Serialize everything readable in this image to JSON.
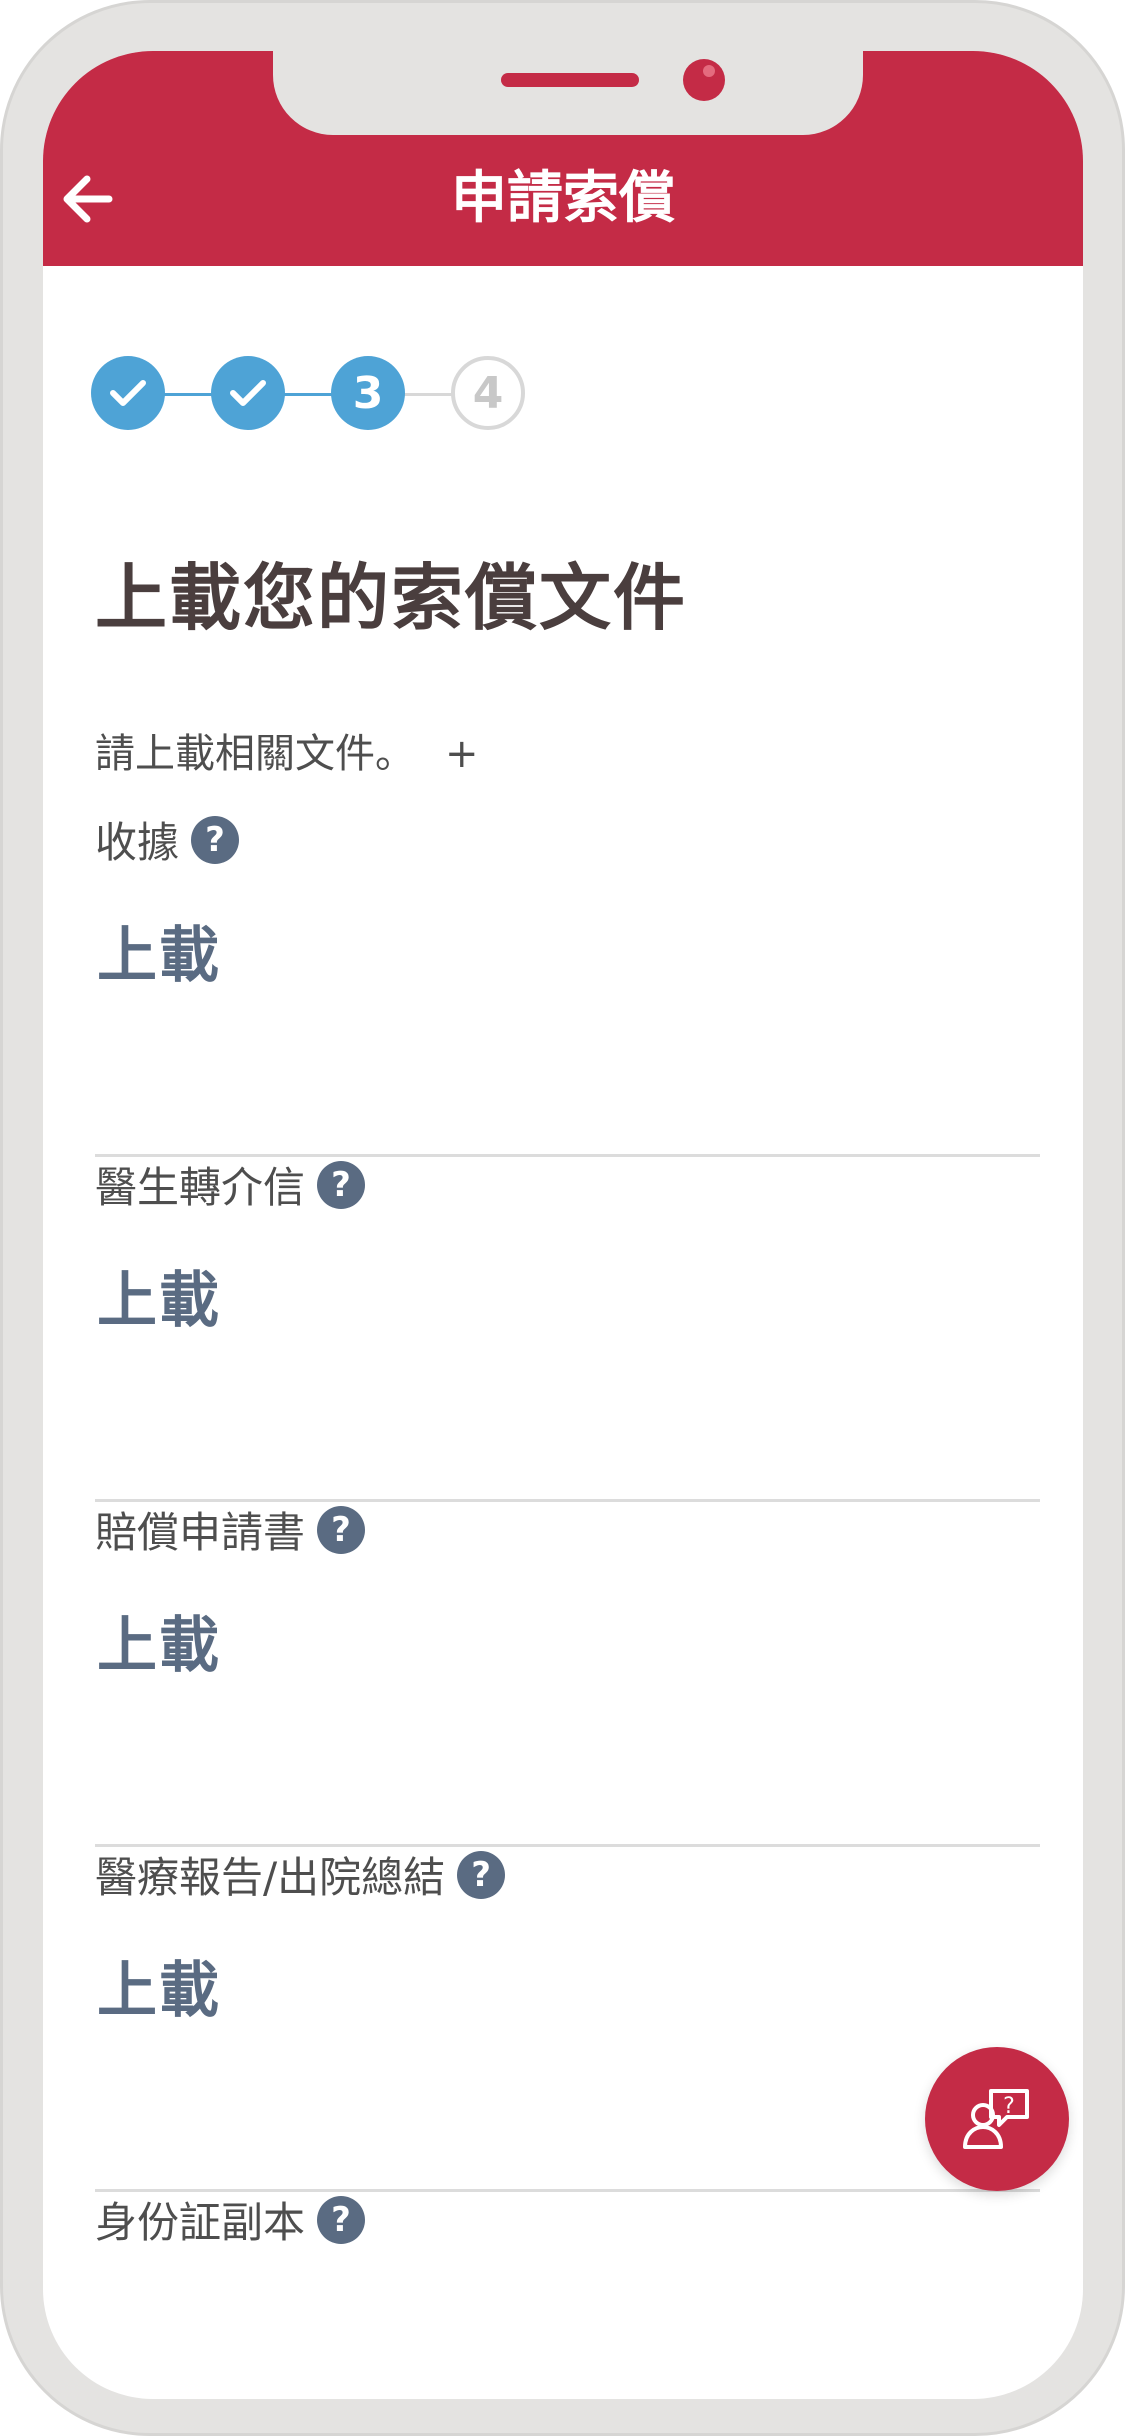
{
  "header": {
    "title": "申請索償",
    "back_icon": "arrow-left-icon"
  },
  "steps": [
    {
      "state": "done",
      "label": ""
    },
    {
      "state": "done",
      "label": ""
    },
    {
      "state": "current",
      "label": "3"
    },
    {
      "state": "todo",
      "label": "4"
    }
  ],
  "page": {
    "heading": "上載您的索償文件",
    "intro": "請上載相關文件。",
    "intro_plus": "+"
  },
  "documents": [
    {
      "label": "收據",
      "help": "?",
      "action": "上載"
    },
    {
      "label": "醫生轉介信",
      "help": "?",
      "action": "上載"
    },
    {
      "label": "賠償申請書",
      "help": "?",
      "action": "上載"
    },
    {
      "label": "醫療報告/出院總結",
      "help": "?",
      "action": "上載"
    },
    {
      "label": "身份証副本",
      "help": "?",
      "action": ""
    }
  ],
  "fab": {
    "icon": "chat-support-icon"
  },
  "colors": {
    "brand_red": "#c42b46",
    "step_blue": "#4ea3d6",
    "upload_text": "#5a6b82"
  }
}
